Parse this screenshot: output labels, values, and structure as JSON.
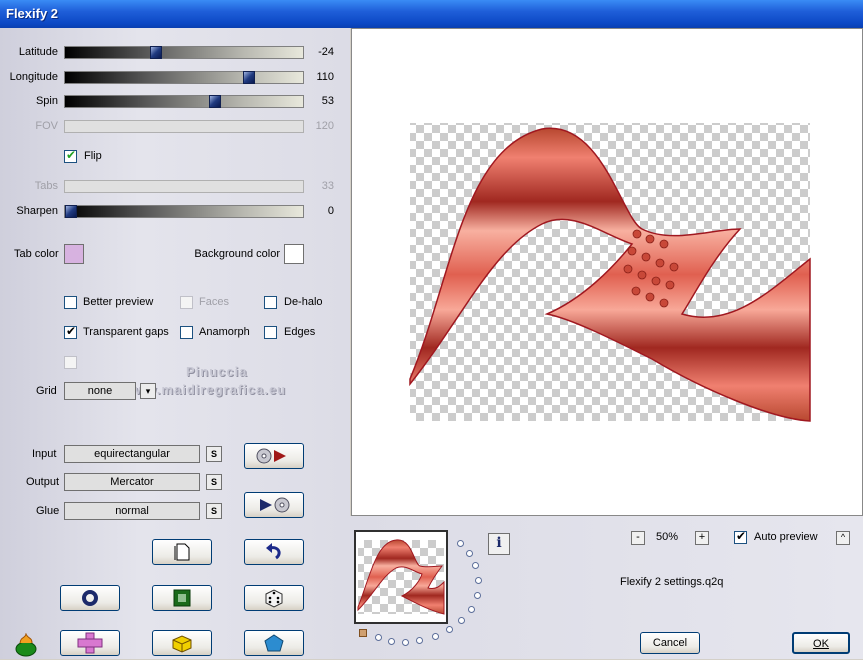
{
  "window": {
    "title": "Flexify 2"
  },
  "sliders": [
    {
      "id": "latitude",
      "label": "Latitude",
      "value": "-24",
      "fraction": 0.375,
      "enabled": true
    },
    {
      "id": "longitude",
      "label": "Longitude",
      "value": "110",
      "fraction": 0.786,
      "enabled": true
    },
    {
      "id": "spin",
      "label": "Spin",
      "value": "53",
      "fraction": 0.635,
      "enabled": true
    },
    {
      "id": "fov",
      "label": "FOV",
      "value": "120",
      "fraction": 1.0,
      "enabled": false
    },
    {
      "id": "tabs",
      "label": "Tabs",
      "value": "33",
      "fraction": 0.33,
      "enabled": false
    },
    {
      "id": "sharpen",
      "label": "Sharpen",
      "value": "0",
      "fraction": 0.0,
      "enabled": true
    }
  ],
  "flip": {
    "label": "Flip",
    "checked": true
  },
  "colors": {
    "tab_color_label": "Tab color",
    "tab_color": "#d7b2e0",
    "background_color_label": "Background color",
    "background_color": "#ffffff"
  },
  "options": {
    "better_preview": {
      "label": "Better preview",
      "checked": false
    },
    "faces": {
      "label": "Faces",
      "checked": false
    },
    "de_halo": {
      "label": "De-halo",
      "checked": false
    },
    "transparent_gaps": {
      "label": "Transparent gaps",
      "checked": true
    },
    "anamorph": {
      "label": "Anamorph",
      "checked": false
    },
    "edges": {
      "label": "Edges",
      "checked": false
    }
  },
  "grid": {
    "label": "Grid",
    "value": "none"
  },
  "watermark": {
    "line1": "Pinuccia",
    "line2": "www.maidiregrafica.eu"
  },
  "projection": {
    "input_label": "Input",
    "input_value": "equirectangular",
    "output_label": "Output",
    "output_value": "Mercator",
    "glue_label": "Glue",
    "glue_value": "normal",
    "swap_symbol": "S"
  },
  "zoom": {
    "minus": "-",
    "plus": "+",
    "value": "50%"
  },
  "auto_preview": {
    "label": "Auto preview",
    "checked": true,
    "toggle_symbol": "^"
  },
  "settings_file": "Flexify 2 settings.q2q",
  "info_symbol": "i",
  "buttons": {
    "cancel": "Cancel",
    "ok": "OK"
  },
  "accent_colors": {
    "ribbon": "#f08070",
    "ribbon_dark": "#a02820",
    "ribbon_light": "#f8b0a0",
    "titlebar": "#0b47c4"
  }
}
